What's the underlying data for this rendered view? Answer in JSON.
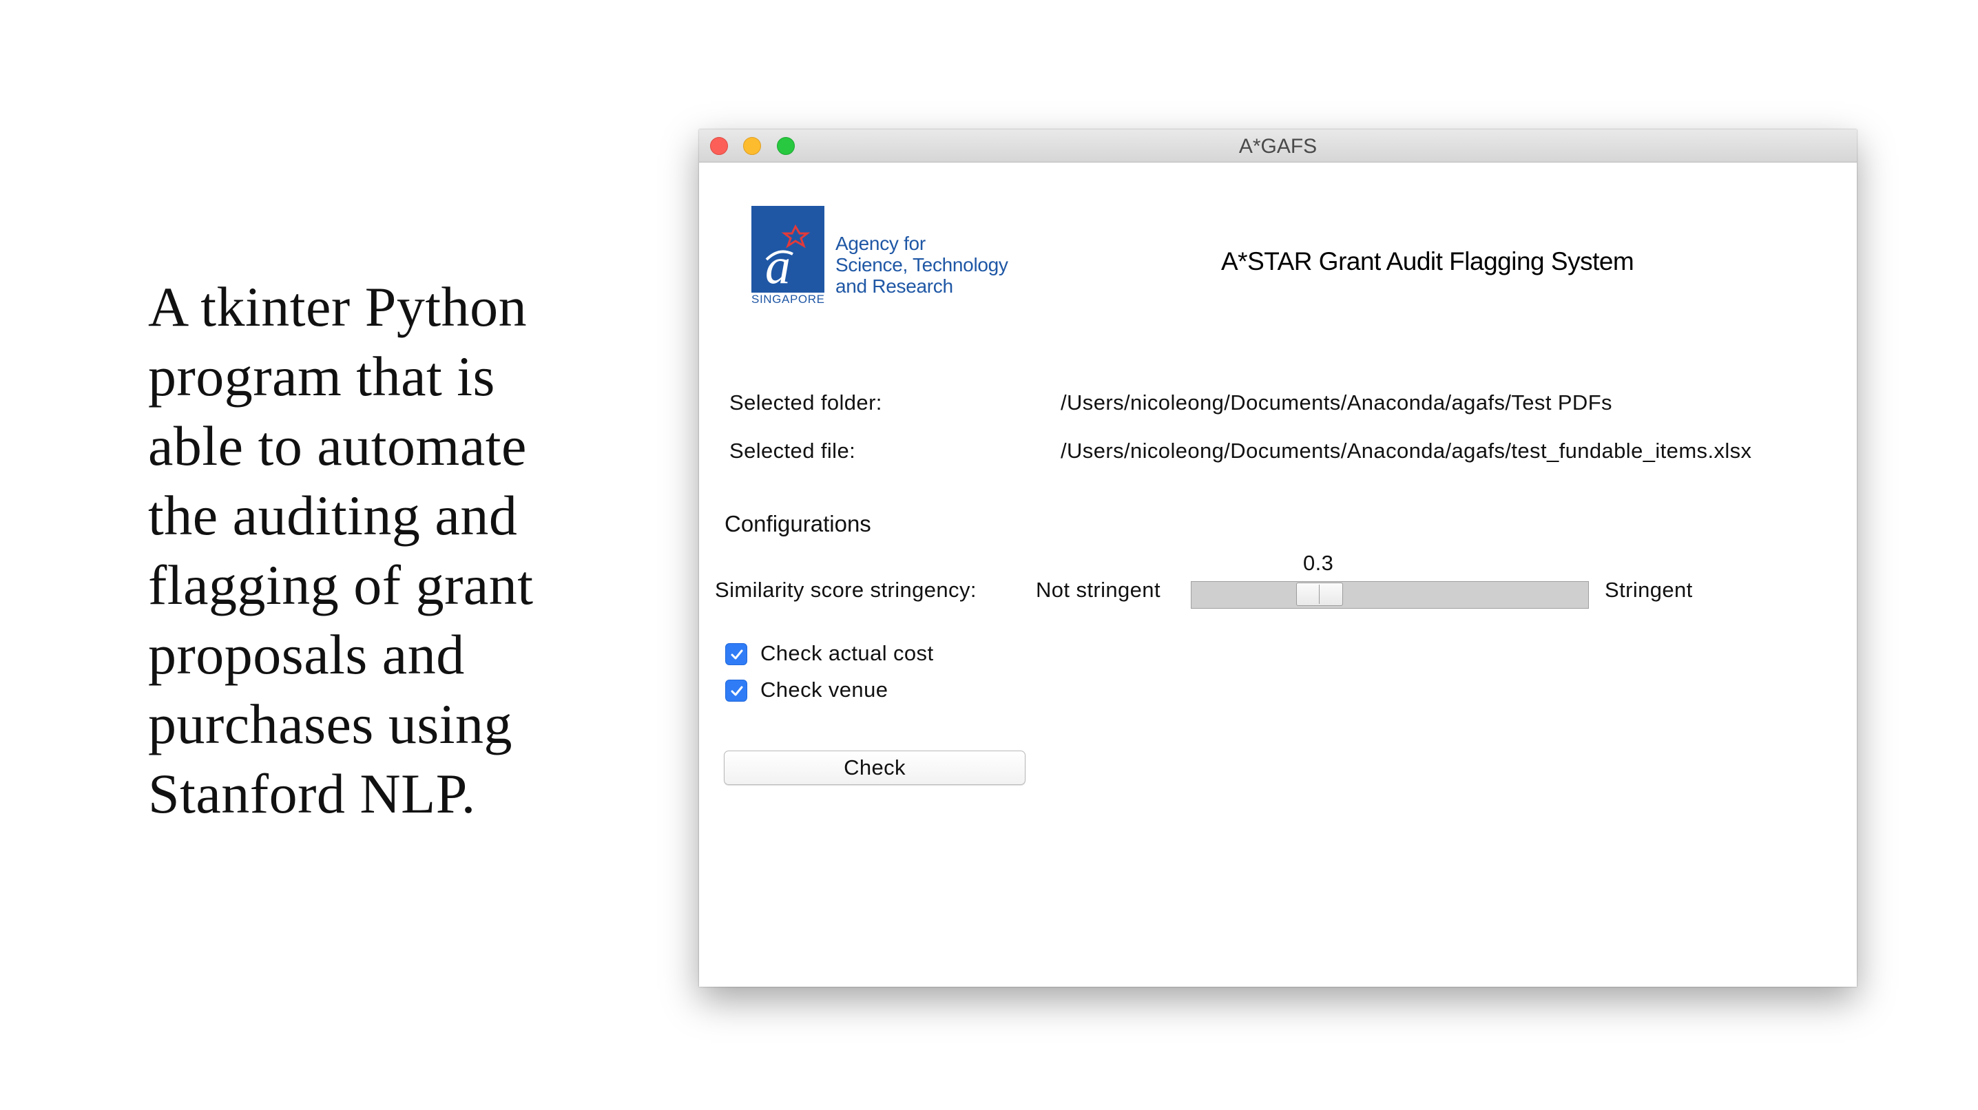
{
  "caption": "A tkinter Python\nprogram that is\nable to automate\nthe auditing and\nflagging of  grant\nproposals and\npurchases using\nStanford NLP.",
  "window": {
    "title": "A*GAFS",
    "logo": {
      "mark_letter": "a",
      "country": "SINGAPORE",
      "text": "Agency for\nScience, Technology\nand Research",
      "brand_color": "#1f57a5",
      "star_color": "#e23a3a"
    },
    "heading": "A*STAR Grant Audit Flagging System",
    "folder": {
      "label": "Selected folder:",
      "value": "/Users/nicoleong/Documents/Anaconda/agafs/Test PDFs"
    },
    "file": {
      "label": "Selected file:",
      "value": "/Users/nicoleong/Documents/Anaconda/agafs/test_fundable_items.xlsx"
    },
    "configurations": {
      "title": "Configurations",
      "stringency": {
        "label": "Similarity score stringency:",
        "min_label": "Not stringent",
        "max_label": "Stringent",
        "value": "0.3",
        "fraction": 0.3
      },
      "checks": [
        {
          "label": "Check actual cost",
          "checked": true
        },
        {
          "label": "Check venue",
          "checked": true
        }
      ]
    },
    "check_button": "Check",
    "accent_color": "#2f7cf6"
  }
}
